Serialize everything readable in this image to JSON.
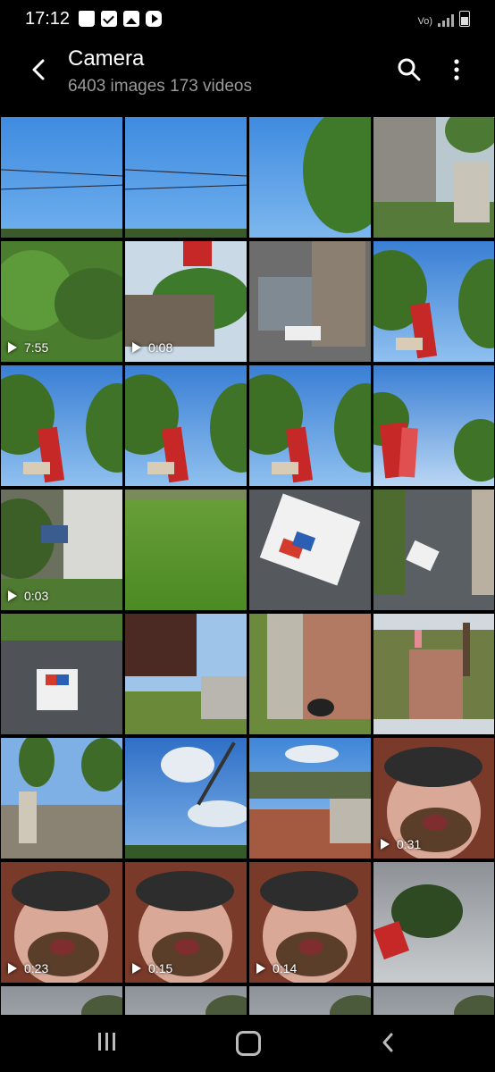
{
  "status_bar": {
    "time": "17:12",
    "left_icons": [
      "shopping-bag-icon",
      "check-box-icon",
      "gallery-icon",
      "youtube-icon"
    ],
    "wifi_calling_label": "Vo)",
    "right_icons": [
      "wifi-calling-icon",
      "signal-icon",
      "battery-icon"
    ]
  },
  "header": {
    "title": "Camera",
    "subtitle": "6403 images 173 videos"
  },
  "colors": {
    "background": "#000000",
    "subtitle": "#9a9a9a",
    "sky_blue": "#3a86d6",
    "grass_green": "#5a8a2c"
  },
  "grid": {
    "items": [
      {
        "kind": "photo",
        "scene": "sky-wires",
        "duration": ""
      },
      {
        "kind": "photo",
        "scene": "sky-wires",
        "duration": ""
      },
      {
        "kind": "photo",
        "scene": "sky-tree",
        "duration": ""
      },
      {
        "kind": "photo",
        "scene": "porch-street",
        "duration": ""
      },
      {
        "kind": "video",
        "scene": "bushes",
        "duration": "7:55"
      },
      {
        "kind": "video",
        "scene": "porch-flag",
        "duration": "0:08"
      },
      {
        "kind": "photo",
        "scene": "porch-floor",
        "duration": ""
      },
      {
        "kind": "photo",
        "scene": "flag-sky",
        "duration": ""
      },
      {
        "kind": "photo",
        "scene": "flag-sky",
        "duration": ""
      },
      {
        "kind": "photo",
        "scene": "flag-sky",
        "duration": ""
      },
      {
        "kind": "photo",
        "scene": "flag-sky",
        "duration": ""
      },
      {
        "kind": "photo",
        "scene": "flag-sky-close",
        "duration": ""
      },
      {
        "kind": "video",
        "scene": "yard",
        "duration": "0:03"
      },
      {
        "kind": "photo",
        "scene": "grass",
        "duration": ""
      },
      {
        "kind": "photo",
        "scene": "valvoline-bag",
        "duration": ""
      },
      {
        "kind": "photo",
        "scene": "sidewalk-bag",
        "duration": ""
      },
      {
        "kind": "photo",
        "scene": "valvoline-bag-small",
        "duration": ""
      },
      {
        "kind": "photo",
        "scene": "street-house",
        "duration": ""
      },
      {
        "kind": "photo",
        "scene": "sidewalk-shadow",
        "duration": ""
      },
      {
        "kind": "photo",
        "scene": "sidewalk-person",
        "duration": ""
      },
      {
        "kind": "photo",
        "scene": "street-sign",
        "duration": ""
      },
      {
        "kind": "photo",
        "scene": "clouds-traffic-light",
        "duration": ""
      },
      {
        "kind": "photo",
        "scene": "intersection",
        "duration": ""
      },
      {
        "kind": "video",
        "scene": "selfie",
        "duration": "0:31"
      },
      {
        "kind": "video",
        "scene": "selfie",
        "duration": "0:23"
      },
      {
        "kind": "video",
        "scene": "selfie",
        "duration": "0:15"
      },
      {
        "kind": "video",
        "scene": "selfie",
        "duration": "0:14"
      },
      {
        "kind": "photo",
        "scene": "overcast-tree",
        "duration": ""
      },
      {
        "kind": "photo",
        "scene": "overcast",
        "duration": ""
      },
      {
        "kind": "photo",
        "scene": "overcast",
        "duration": ""
      },
      {
        "kind": "photo",
        "scene": "overcast",
        "duration": ""
      },
      {
        "kind": "photo",
        "scene": "overcast",
        "duration": ""
      }
    ]
  },
  "nav_bar": {
    "icons": [
      "recent-apps-icon",
      "home-icon",
      "back-icon"
    ]
  }
}
